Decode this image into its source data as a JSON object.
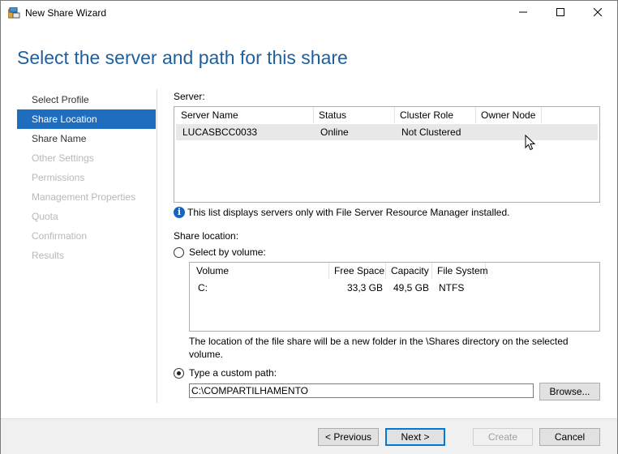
{
  "window": {
    "title": "New Share Wizard"
  },
  "heading": "Select the server and path for this share",
  "nav": [
    {
      "label": "Select Profile",
      "state": "done"
    },
    {
      "label": "Share Location",
      "state": "active"
    },
    {
      "label": "Share Name",
      "state": "done"
    },
    {
      "label": "Other Settings",
      "state": "disabled"
    },
    {
      "label": "Permissions",
      "state": "disabled"
    },
    {
      "label": "Management Properties",
      "state": "disabled"
    },
    {
      "label": "Quota",
      "state": "disabled"
    },
    {
      "label": "Confirmation",
      "state": "disabled"
    },
    {
      "label": "Results",
      "state": "disabled"
    }
  ],
  "server": {
    "label": "Server:",
    "columns": [
      "Server Name",
      "Status",
      "Cluster Role",
      "Owner Node"
    ],
    "rows": [
      [
        "LUCASBCC0033",
        "Online",
        "Not Clustered",
        ""
      ]
    ]
  },
  "info_text": "This list displays servers only with File Server Resource Manager installed.",
  "share_location": {
    "label": "Share location:",
    "by_volume_label": "Select by volume:",
    "volume_columns": [
      "Volume",
      "Free Space",
      "Capacity",
      "File System"
    ],
    "volume_rows": [
      [
        "C:",
        "33,3 GB",
        "49,5 GB",
        "NTFS"
      ]
    ],
    "description": "The location of the file share will be a new folder in the \\Shares directory on the selected volume.",
    "custom_path_label": "Type a custom path:",
    "custom_path_value": "C:\\COMPARTILHAMENTO",
    "browse_label": "Browse..."
  },
  "buttons": {
    "previous": "< Previous",
    "next": "Next >",
    "create": "Create",
    "cancel": "Cancel"
  },
  "icons": {
    "app": "share-wizard-icon",
    "minimize": "minimize-icon",
    "maximize": "maximize-icon",
    "close": "close-icon",
    "info": "info-icon",
    "cursor": "mouse-pointer-icon"
  },
  "colors": {
    "heading": "#1f5f9f",
    "nav_active": "#1e6dbf",
    "info_icon": "#1565c0"
  }
}
